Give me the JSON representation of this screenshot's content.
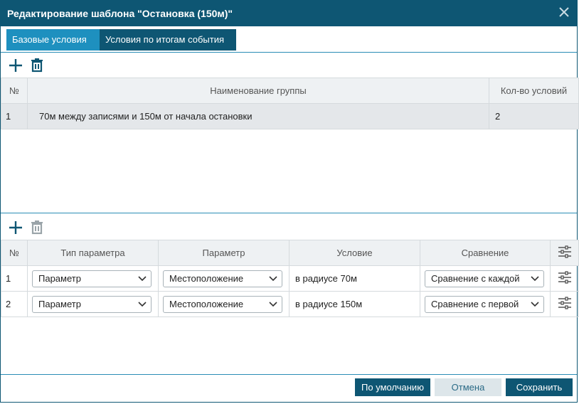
{
  "dialog": {
    "title": "Редактирование шаблона \"Остановка (150м)\"",
    "close_icon": "close-icon"
  },
  "tabs": [
    {
      "label": "Базовые условия",
      "active": true
    },
    {
      "label": "Условия по итогам события",
      "active": false
    }
  ],
  "groups": {
    "toolbar": {
      "add_icon": "plus-icon",
      "delete_icon": "trash-icon"
    },
    "columns": [
      "№",
      "Наименование группы",
      "Кол-во условий"
    ],
    "rows": [
      {
        "num": "1",
        "name": "70м между записями и 150м от начала остановки",
        "count": "2"
      }
    ]
  },
  "conditions": {
    "toolbar": {
      "add_icon": "plus-icon",
      "delete_icon": "trash-icon"
    },
    "columns": [
      "№",
      "Тип параметра",
      "Параметр",
      "Условие",
      "Сравнение"
    ],
    "settings_icon": "sliders-icon",
    "rows": [
      {
        "num": "1",
        "type": "Параметр",
        "param": "Местоположение",
        "condition": "в радиусе 70м",
        "compare": "Сравнение с каждой"
      },
      {
        "num": "2",
        "type": "Параметр",
        "param": "Местоположение",
        "condition": "в радиусе 150м",
        "compare": "Сравнение с первой"
      }
    ]
  },
  "footer": {
    "default_label": "По умолчанию",
    "cancel_label": "Отмена",
    "save_label": "Сохранить"
  },
  "colors": {
    "header": "#0e5673",
    "active_tab": "#1e90bf",
    "accent": "#2a8db5"
  }
}
